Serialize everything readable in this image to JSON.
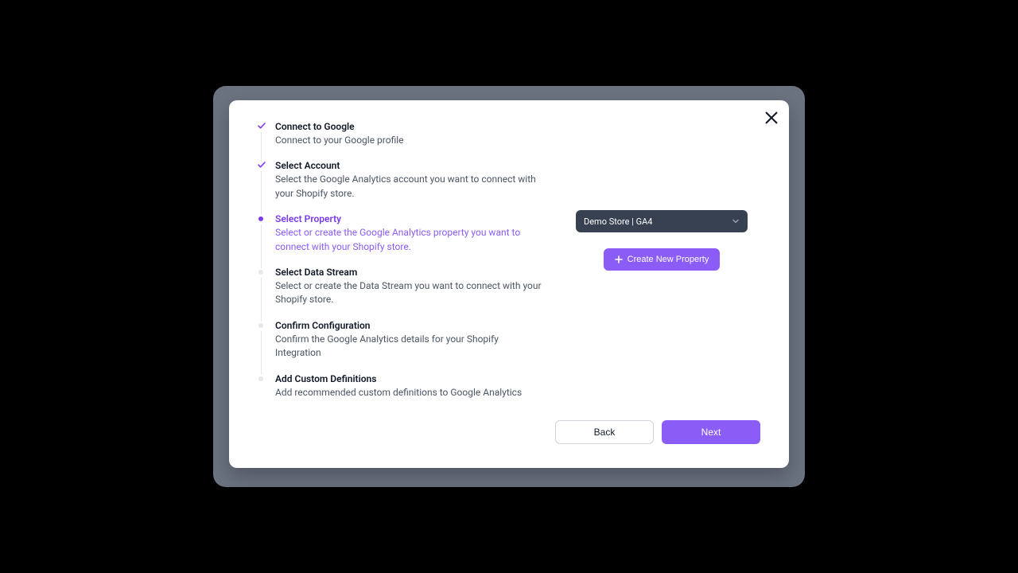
{
  "steps": [
    {
      "title": "Connect to Google",
      "desc": "Connect to your Google profile"
    },
    {
      "title": "Select Account",
      "desc": "Select the Google Analytics account you want to connect with your Shopify store."
    },
    {
      "title": "Select Property",
      "desc": "Select or create the Google Analytics property you want to connect with your Shopify store."
    },
    {
      "title": "Select Data Stream",
      "desc": "Select or create the Data Stream you want to connect with your Shopify store."
    },
    {
      "title": "Confirm Configuration",
      "desc": "Confirm the Google Analytics details for your Shopify Integration"
    },
    {
      "title": "Add Custom Definitions",
      "desc": "Add recommended custom definitions to Google Analytics"
    }
  ],
  "property_select": {
    "value": "Demo Store | GA4"
  },
  "buttons": {
    "create_property": "Create New Property",
    "back": "Back",
    "next": "Next"
  }
}
